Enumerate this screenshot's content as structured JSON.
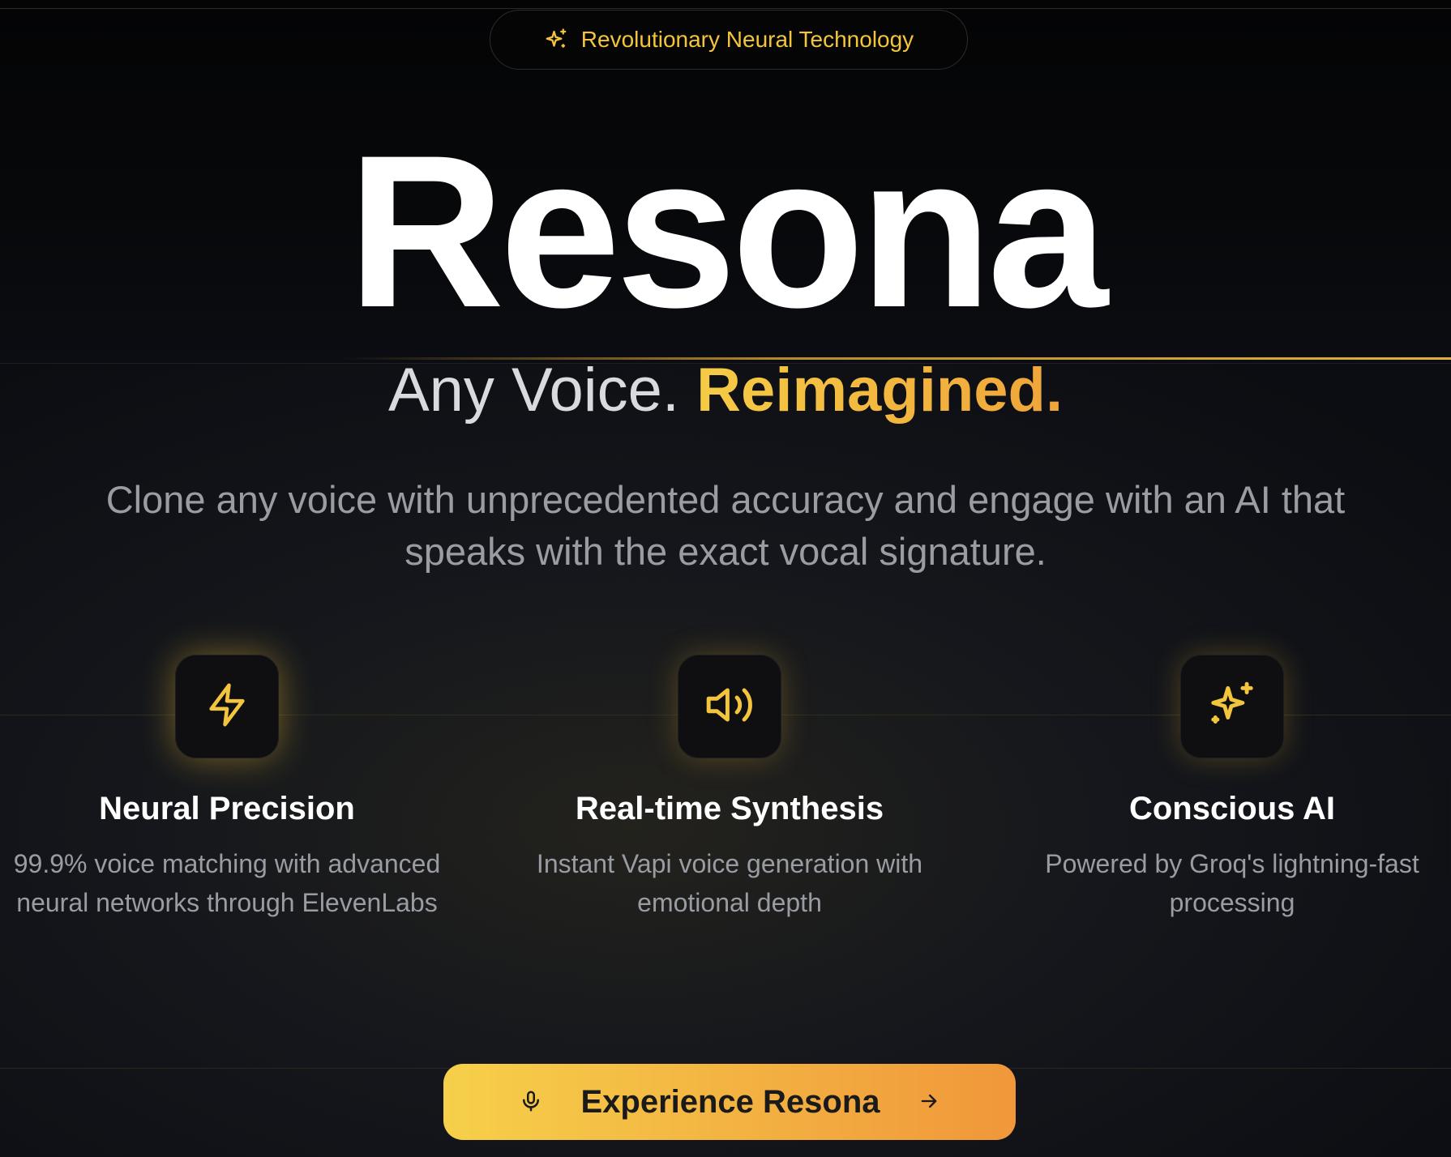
{
  "badge": {
    "label": "Revolutionary Neural Technology",
    "icon": "sparkles-icon"
  },
  "hero": {
    "title": "Resona"
  },
  "tagline": {
    "prefix": "Any Voice. ",
    "accent": "Reimagined."
  },
  "description": "Clone any voice with unprecedented accuracy and engage with an AI that speaks with the exact vocal signature.",
  "features": [
    {
      "icon": "lightning-icon",
      "title": "Neural Precision",
      "description": "99.9% voice matching with advanced neural networks through ElevenLabs"
    },
    {
      "icon": "speaker-icon",
      "title": "Real-time Synthesis",
      "description": "Instant Vapi voice generation with emotional depth"
    },
    {
      "icon": "sparkles-icon",
      "title": "Conscious AI",
      "description": "Powered by Groq's lightning-fast processing"
    }
  ],
  "cta": {
    "label": "Experience Resona",
    "left_icon": "microphone-icon",
    "right_icon": "arrow-right-icon"
  },
  "colors": {
    "accent_gold": "#f2c53d",
    "accent_orange": "#f0973a",
    "background": "#0b0d12"
  }
}
